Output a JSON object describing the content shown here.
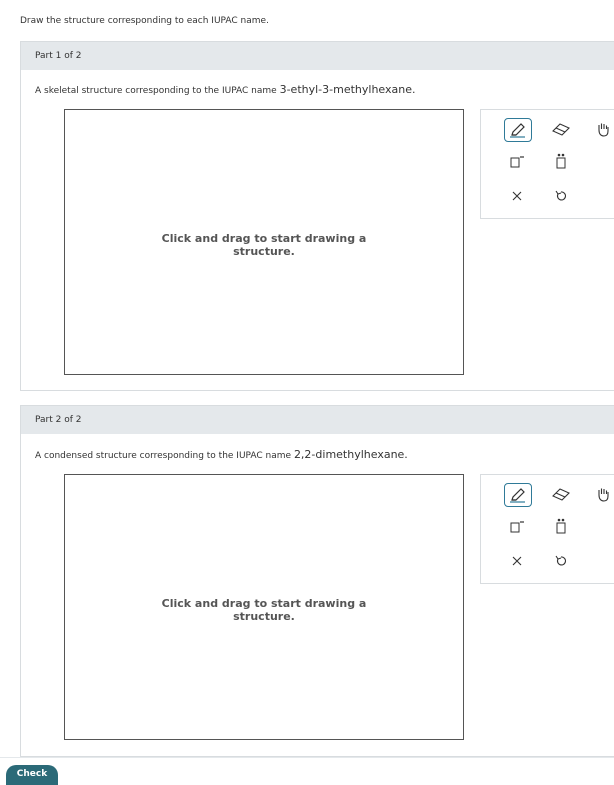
{
  "instruction": "Draw the structure corresponding to each IUPAC name.",
  "parts": [
    {
      "header": "Part 1 of 2",
      "prompt_prefix": "A skeletal structure corresponding to the IUPAC name",
      "iupac_name": "3-ethyl-3-methylhexane.",
      "canvas_line1": "Click and drag to start drawing a",
      "canvas_line2": "structure."
    },
    {
      "header": "Part 2 of 2",
      "prompt_prefix": "A condensed structure corresponding to the IUPAC name",
      "iupac_name": "2,2-dimethylhexane.",
      "canvas_line1": "Click and drag to start drawing a",
      "canvas_line2": "structure."
    }
  ],
  "toolbar_icons": [
    "pencil-icon",
    "eraser-icon",
    "hand-icon",
    "template-icon",
    "charge-icon",
    "lone-pair-icon",
    "clear-icon",
    "undo-icon",
    "redo-icon"
  ],
  "check_label": "Check",
  "colors": {
    "accent": "#2f7a98",
    "header_bg": "#e4e8eb",
    "check_bg": "#2b6a78"
  }
}
